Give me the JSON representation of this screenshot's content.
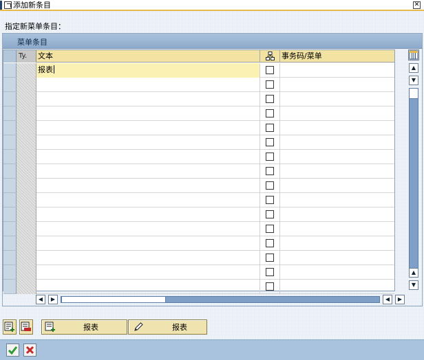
{
  "window": {
    "title": "添加新条目"
  },
  "section_label": "指定新菜单条目：",
  "panel": {
    "title": "菜单条目"
  },
  "table": {
    "columns": {
      "type": "Ty.",
      "text": "文本",
      "tcode_menu": "事务码/菜单"
    },
    "rows": [
      {
        "text": "报表",
        "checked": false,
        "tcode": "",
        "active": true
      },
      {
        "text": "",
        "checked": false,
        "tcode": ""
      },
      {
        "text": "",
        "checked": false,
        "tcode": ""
      },
      {
        "text": "",
        "checked": false,
        "tcode": ""
      },
      {
        "text": "",
        "checked": false,
        "tcode": ""
      },
      {
        "text": "",
        "checked": false,
        "tcode": ""
      },
      {
        "text": "",
        "checked": false,
        "tcode": ""
      },
      {
        "text": "",
        "checked": false,
        "tcode": ""
      },
      {
        "text": "",
        "checked": false,
        "tcode": ""
      },
      {
        "text": "",
        "checked": false,
        "tcode": ""
      },
      {
        "text": "",
        "checked": false,
        "tcode": ""
      },
      {
        "text": "",
        "checked": false,
        "tcode": ""
      },
      {
        "text": "",
        "checked": false,
        "tcode": ""
      },
      {
        "text": "",
        "checked": false,
        "tcode": ""
      },
      {
        "text": "",
        "checked": false,
        "tcode": ""
      },
      {
        "text": "",
        "checked": false,
        "tcode": ""
      }
    ]
  },
  "toolbar": {
    "add_entry_icon": "add-row-icon",
    "delete_entry_icon": "delete-row-icon",
    "insert_button_label": "报表",
    "insert_button_icon": "insert-entry-icon",
    "edit_button_label": "报表",
    "edit_button_icon": "pencil-icon"
  },
  "footer": {
    "confirm_icon": "checkmark-icon",
    "cancel_icon": "cancel-x-icon"
  },
  "colors": {
    "header_yellow": "#f2e3a2",
    "panel_blue": "#a9c1dc",
    "active_cell": "#fbf1b3",
    "confirm_green": "#2f9a2f",
    "cancel_red": "#c52a2a"
  }
}
